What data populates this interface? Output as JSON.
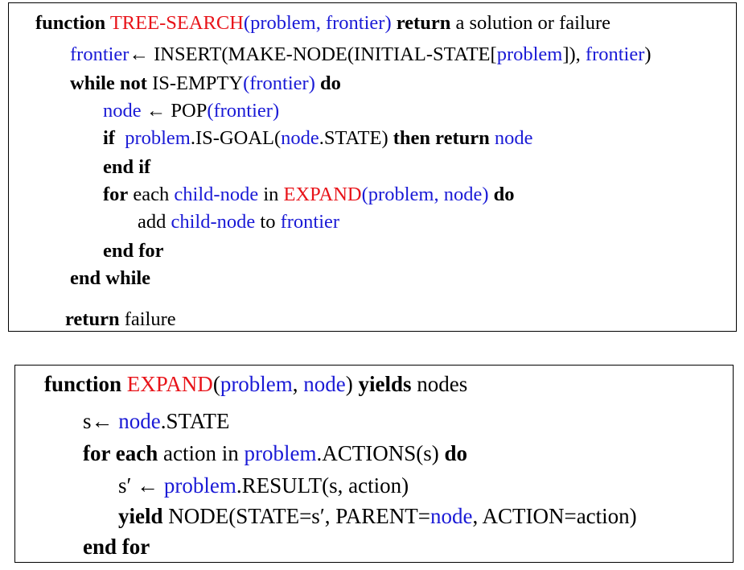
{
  "colors": {
    "keyword": "#000000",
    "variable": "#1a1ad6",
    "function_name": "#e8141a",
    "border": "#000000"
  },
  "tree_search": {
    "lines": [
      [
        {
          "t": "function",
          "c": "kw"
        },
        {
          "t": " ",
          "c": "tx"
        },
        {
          "t": "TREE-SEARCH",
          "c": "fn"
        },
        {
          "t": "(",
          "c": "var"
        },
        {
          "t": "problem",
          "c": "var"
        },
        {
          "t": ", ",
          "c": "var"
        },
        {
          "t": "frontier",
          "c": "var"
        },
        {
          "t": ")",
          "c": "var"
        },
        {
          "t": " ",
          "c": "tx"
        },
        {
          "t": "return",
          "c": "kw"
        },
        {
          "t": " a solution or failure",
          "c": "tx"
        }
      ],
      [
        {
          "t": "frontier",
          "c": "var"
        },
        {
          "t": "← INSERT(MAKE-NODE(INITIAL-STATE[",
          "c": "tx"
        },
        {
          "t": "problem",
          "c": "var"
        },
        {
          "t": "]), ",
          "c": "tx"
        },
        {
          "t": "frontier",
          "c": "var"
        },
        {
          "t": ")",
          "c": "tx"
        }
      ],
      [
        {
          "t": "while not",
          "c": "kw"
        },
        {
          "t": " IS-EMPTY",
          "c": "tx"
        },
        {
          "t": "(frontier)",
          "c": "var"
        },
        {
          "t": " ",
          "c": "tx"
        },
        {
          "t": "do",
          "c": "kw"
        }
      ],
      [
        {
          "t": "node",
          "c": "var"
        },
        {
          "t": " ← POP",
          "c": "tx"
        },
        {
          "t": "(frontier)",
          "c": "var"
        }
      ],
      [
        {
          "t": "if",
          "c": "kw"
        },
        {
          "t": "  ",
          "c": "tx"
        },
        {
          "t": "problem",
          "c": "var"
        },
        {
          "t": ".IS-GOAL(",
          "c": "tx"
        },
        {
          "t": "node",
          "c": "var"
        },
        {
          "t": ".STATE) ",
          "c": "tx"
        },
        {
          "t": "then return",
          "c": "kw"
        },
        {
          "t": " ",
          "c": "tx"
        },
        {
          "t": "node",
          "c": "var"
        }
      ],
      [
        {
          "t": "end if",
          "c": "kw"
        }
      ],
      [
        {
          "t": "for",
          "c": "kw"
        },
        {
          "t": " each ",
          "c": "tx"
        },
        {
          "t": "child-node",
          "c": "var"
        },
        {
          "t": " in ",
          "c": "tx"
        },
        {
          "t": "EXPAND",
          "c": "fn"
        },
        {
          "t": "(problem, node)",
          "c": "var"
        },
        {
          "t": " ",
          "c": "tx"
        },
        {
          "t": "do",
          "c": "kw"
        }
      ],
      [
        {
          "t": "add ",
          "c": "tx"
        },
        {
          "t": "child-node",
          "c": "var"
        },
        {
          "t": " to ",
          "c": "tx"
        },
        {
          "t": "frontier",
          "c": "var"
        }
      ],
      [
        {
          "t": "end for",
          "c": "kw"
        }
      ],
      [
        {
          "t": "end while",
          "c": "kw"
        }
      ],
      [
        {
          "t": "return",
          "c": "kw"
        },
        {
          "t": " failure",
          "c": "tx"
        }
      ]
    ]
  },
  "expand": {
    "lines": [
      [
        {
          "t": "function",
          "c": "kw"
        },
        {
          "t": " ",
          "c": "tx"
        },
        {
          "t": "EXPAND",
          "c": "fn"
        },
        {
          "t": "(",
          "c": "tx"
        },
        {
          "t": "problem",
          "c": "var"
        },
        {
          "t": ", ",
          "c": "tx"
        },
        {
          "t": "node",
          "c": "var"
        },
        {
          "t": ") ",
          "c": "tx"
        },
        {
          "t": "yields",
          "c": "kw"
        },
        {
          "t": " nodes",
          "c": "tx"
        }
      ],
      [
        {
          "t": "s← ",
          "c": "tx"
        },
        {
          "t": "node",
          "c": "var"
        },
        {
          "t": ".STATE",
          "c": "tx"
        }
      ],
      [
        {
          "t": "for each",
          "c": "kw"
        },
        {
          "t": " action in ",
          "c": "tx"
        },
        {
          "t": "problem",
          "c": "var"
        },
        {
          "t": ".ACTIONS(s) ",
          "c": "tx"
        },
        {
          "t": "do",
          "c": "kw"
        }
      ],
      [
        {
          "t": "s′ ← ",
          "c": "tx"
        },
        {
          "t": "problem",
          "c": "var"
        },
        {
          "t": ".RESULT(s, action)",
          "c": "tx"
        }
      ],
      [
        {
          "t": "yield",
          "c": "kw"
        },
        {
          "t": " NODE(STATE=s′, PARENT=",
          "c": "tx"
        },
        {
          "t": "node",
          "c": "var"
        },
        {
          "t": ", ACTION=action)",
          "c": "tx"
        }
      ],
      [
        {
          "t": "end for",
          "c": "kw"
        }
      ]
    ]
  }
}
